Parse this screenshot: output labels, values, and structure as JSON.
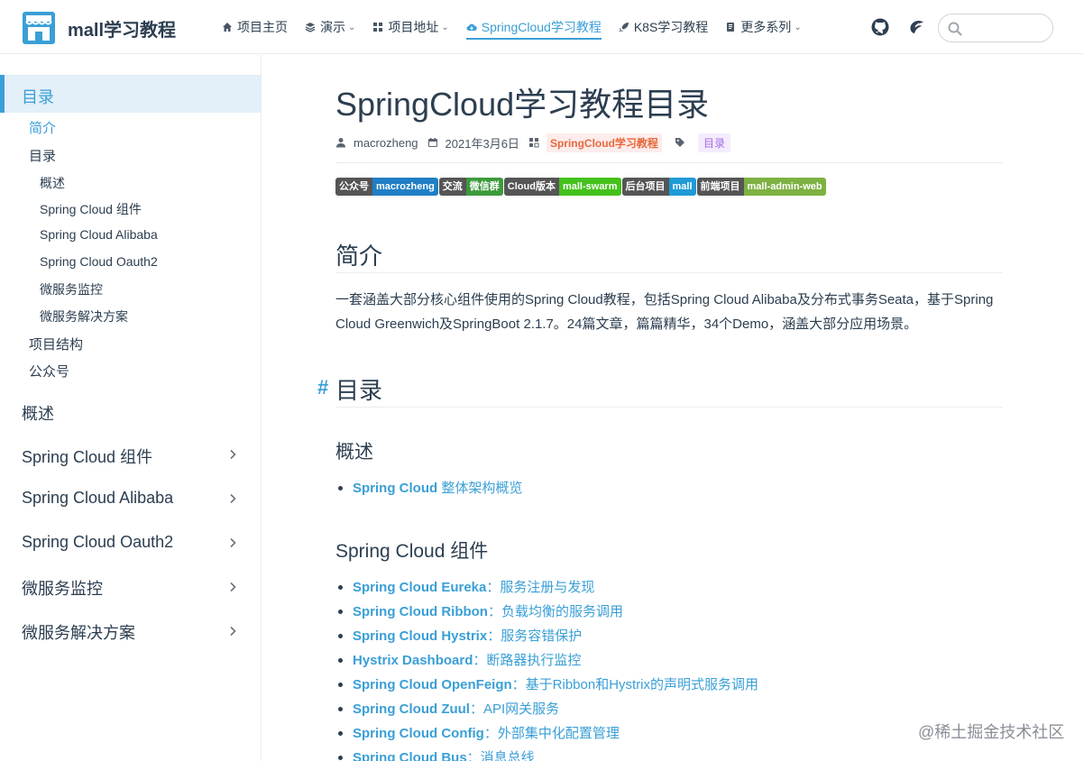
{
  "site": {
    "name": "mall学习教程"
  },
  "nav": {
    "items": [
      {
        "label": "项目主页",
        "icon": "home-icon",
        "dropdown": false,
        "active": false
      },
      {
        "label": "演示",
        "icon": "layers-icon",
        "dropdown": true,
        "active": false
      },
      {
        "label": "项目地址",
        "icon": "grid-icon",
        "dropdown": true,
        "active": false
      },
      {
        "label": "SpringCloud学习教程",
        "icon": "cloud-icon",
        "dropdown": false,
        "active": true
      },
      {
        "label": "K8S学习教程",
        "icon": "rocket-icon",
        "dropdown": false,
        "active": false
      },
      {
        "label": "更多系列",
        "icon": "book-icon",
        "dropdown": true,
        "active": false
      }
    ],
    "search_placeholder": ""
  },
  "sidebar": {
    "group_title": "目录",
    "sub_items": [
      {
        "label": "简介",
        "level": 1,
        "active": true
      },
      {
        "label": "目录",
        "level": 1,
        "active": false
      },
      {
        "label": "概述",
        "level": 2
      },
      {
        "label": "Spring Cloud 组件",
        "level": 2
      },
      {
        "label": "Spring Cloud Alibaba",
        "level": 2
      },
      {
        "label": "Spring Cloud Oauth2",
        "level": 2
      },
      {
        "label": "微服务监控",
        "level": 2
      },
      {
        "label": "微服务解决方案",
        "level": 2
      },
      {
        "label": "项目结构",
        "level": 1
      },
      {
        "label": "公众号",
        "level": 1
      }
    ],
    "groups": [
      {
        "label": "概述",
        "collapsible": false
      },
      {
        "label": "Spring Cloud 组件",
        "collapsible": true
      },
      {
        "label": "Spring Cloud Alibaba",
        "collapsible": true
      },
      {
        "label": "Spring Cloud Oauth2",
        "collapsible": true
      },
      {
        "label": "微服务监控",
        "collapsible": true
      },
      {
        "label": "微服务解决方案",
        "collapsible": true
      }
    ]
  },
  "article": {
    "title": "SpringCloud学习教程目录",
    "author": "macrozheng",
    "date": "2021年3月6日",
    "category": "SpringCloud学习教程",
    "tag": "目录",
    "badges": [
      {
        "left": "公众号",
        "right": "macrozheng",
        "color": "#1f7ec5"
      },
      {
        "left": "交流",
        "right": "微信群",
        "color": "#3c9a3b"
      },
      {
        "left": "Cloud版本",
        "right": "mall-swarm",
        "color": "#44c11b"
      },
      {
        "left": "后台项目",
        "right": "mall",
        "color": "#1f9ad6"
      },
      {
        "left": "前端项目",
        "right": "mall-admin-web",
        "color": "#7db142"
      }
    ],
    "intro_heading": "简介",
    "intro_text": "一套涵盖大部分核心组件使用的Spring Cloud教程，包括Spring Cloud Alibaba及分布式事务Seata，基于Spring Cloud Greenwich及SpringBoot 2.1.7。24篇文章，篇篇精华，34个Demo，涵盖大部分应用场景。",
    "toc_hash": "#",
    "toc_heading": "目录",
    "overview_heading": "概述",
    "overview_links": [
      {
        "name": "Spring Cloud",
        "desc": " 整体架构概览"
      }
    ],
    "components_heading": "Spring Cloud 组件",
    "components_links": [
      {
        "name": "Spring Cloud Eureka",
        "desc": "：服务注册与发现"
      },
      {
        "name": "Spring Cloud Ribbon",
        "desc": "：负载均衡的服务调用"
      },
      {
        "name": "Spring Cloud Hystrix",
        "desc": "：服务容错保护"
      },
      {
        "name": "Hystrix Dashboard",
        "desc": "：断路器执行监控"
      },
      {
        "name": "Spring Cloud OpenFeign",
        "desc": "：基于Ribbon和Hystrix的声明式服务调用"
      },
      {
        "name": "Spring Cloud Zuul",
        "desc": "：API网关服务"
      },
      {
        "name": "Spring Cloud Config",
        "desc": "：外部集中化配置管理"
      },
      {
        "name": "Spring Cloud Bus",
        "desc": "：消息总线"
      }
    ]
  },
  "watermark": "@稀土掘金技术社区",
  "colors": {
    "accent": "#3a9fd6",
    "text": "#2c3e50",
    "sidebar_active_bg": "#e3eff9"
  }
}
